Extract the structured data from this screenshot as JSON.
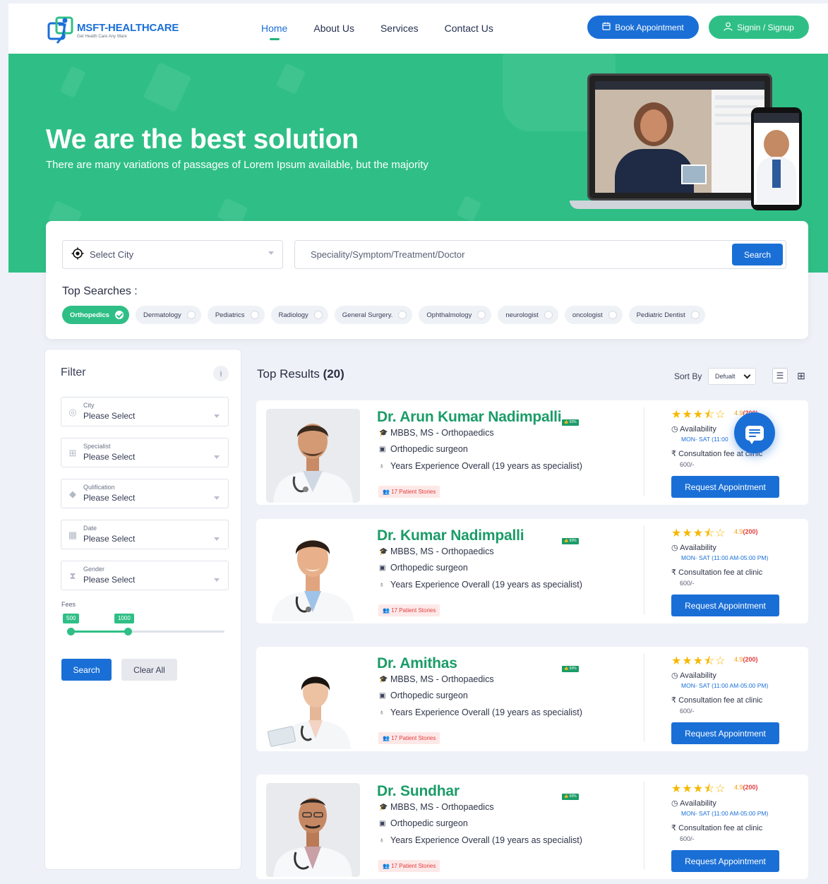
{
  "brand": {
    "name": "MSFT-HEALTHCARE",
    "tagline": "Get Health Care Any Ware"
  },
  "nav": {
    "items": [
      "Home",
      "About Us",
      "Services",
      "Contact Us"
    ],
    "active": "Home"
  },
  "header_buttons": {
    "book": "Book Appointment",
    "signin": "Signin / Signup"
  },
  "hero": {
    "title": "We are the best solution",
    "subtitle": "There are many variations of passages of Lorem Ipsum available, but the majority"
  },
  "search": {
    "city_placeholder": "Select City",
    "query_placeholder": "Speciality/Symptom/Treatment/Doctor",
    "button": "Search",
    "top_label": "Top Searches :",
    "chips": [
      "Orthopedics",
      "Dermatology",
      "Pediatrics",
      "Radiology",
      "General Surgery.",
      "Ophthalmology",
      "neurologist",
      "oncologist",
      "Pediatric Dentist"
    ],
    "active_chip": "Orthopedics"
  },
  "filter": {
    "title": "Filter",
    "fields": [
      {
        "label": "City",
        "value": "Please Select",
        "icon": "location-icon"
      },
      {
        "label": "Specialist",
        "value": "Please Select",
        "icon": "medkit-icon"
      },
      {
        "label": "Qulification",
        "value": "Please Select",
        "icon": "graduation-cap-icon"
      },
      {
        "label": "Date",
        "value": "Please Select",
        "icon": "calendar-icon"
      },
      {
        "label": "Gender",
        "value": "Please Select",
        "icon": "hourglass-icon"
      }
    ],
    "fees_label": "Fees",
    "fees_min": "500",
    "fees_max": "1000",
    "fees_range_fill": 0.37,
    "search_button": "Search",
    "clear_button": "Clear All"
  },
  "results": {
    "title": "Top Results",
    "count": "(20)",
    "sort_label": "Sort By",
    "sort_value": "Defualt",
    "doctors": [
      {
        "name": "Dr. Arun Kumar Nadimpalli",
        "badge": "93%",
        "degree": "MBBS, MS -  Orthopaedics",
        "role": "Orthopedic surgeon",
        "experience": "Years Experience Overall  (19 years as specialist)",
        "stories": "17 Patient Stories",
        "rating": "4.9",
        "reviews": "(200)",
        "availability_label": "Availability",
        "availability": "MON- SAT (11:00",
        "fee_label": "Consultation fee at clinic",
        "fee": "600/-",
        "button": "Request Appointment",
        "stars": 3.5
      },
      {
        "name": "Dr. Kumar Nadimpalli",
        "badge": "93%",
        "degree": "MBBS, MS -  Orthopaedics",
        "role": "Orthopedic surgeon",
        "experience": "Years Experience Overall  (19 years as specialist)",
        "stories": "17 Patient Stories",
        "rating": "4.9",
        "reviews": "(200)",
        "availability_label": "Availability",
        "availability": "MON- SAT (11:00 AM-05:00 PM)",
        "fee_label": "Consultation fee at clinic",
        "fee": "600/-",
        "button": "Request Appointment",
        "stars": 3.5
      },
      {
        "name": "Dr. Amithas",
        "badge": "93%",
        "degree": "MBBS, MS -  Orthopaedics",
        "role": "Orthopedic surgeon",
        "experience": "Years Experience Overall  (19 years as specialist)",
        "stories": "17 Patient Stories",
        "rating": "4.9",
        "reviews": "(200)",
        "availability_label": "Availability",
        "availability": "MON- SAT (11:00 AM-05:00 PM)",
        "fee_label": "Consultation fee at clinic",
        "fee": "600/-",
        "button": "Request Appointment",
        "stars": 3.5
      },
      {
        "name": "Dr. Sundhar",
        "badge": "93%",
        "degree": "MBBS, MS -  Orthopaedics",
        "role": "Orthopedic surgeon",
        "experience": "Years Experience Overall  (19 years as specialist)",
        "stories": "17 Patient Stories",
        "rating": "4.9",
        "reviews": "(200)",
        "availability_label": "Availability",
        "availability": "MON- SAT (11:00 AM-05:00 PM)",
        "fee_label": "Consultation fee at clinic",
        "fee": "600/-",
        "button": "Request Appointment",
        "stars": 3.5
      }
    ]
  },
  "colors": {
    "primary": "#1a6fd6",
    "accent": "#2fbf86",
    "doctor_name": "#1b9c68",
    "star": "#f6b800"
  }
}
